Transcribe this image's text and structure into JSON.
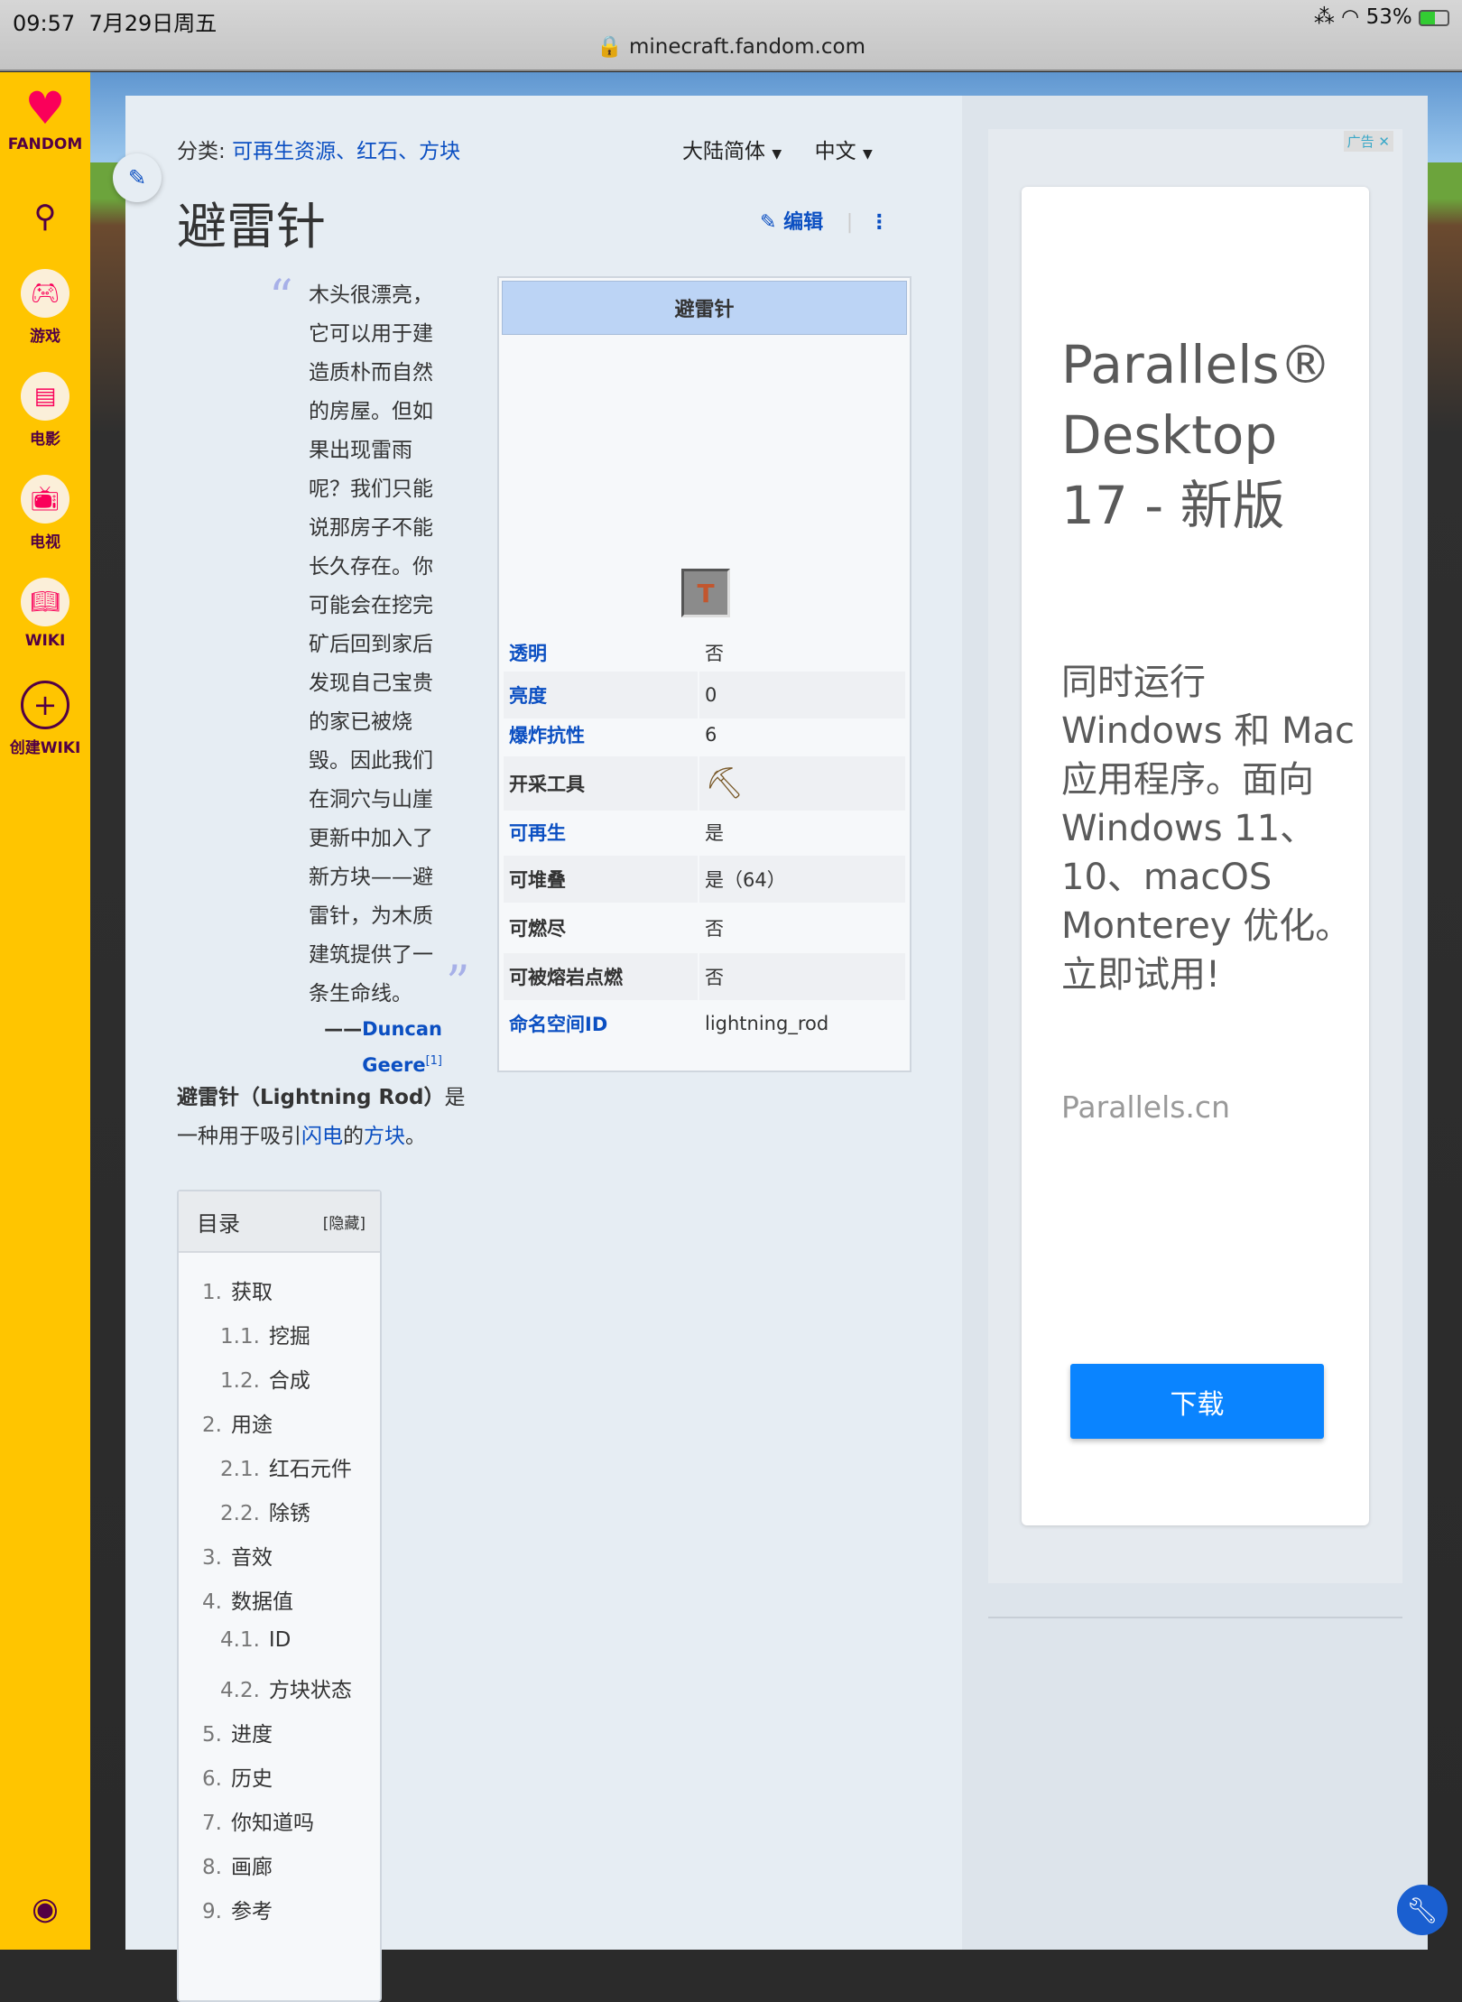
{
  "status": {
    "time": "09:57",
    "date": "7月29日周五",
    "battery": "53%",
    "url": "minecraft.fandom.com"
  },
  "rail": {
    "logo": "FANDOM",
    "items": [
      {
        "label": "游戏",
        "icon": "gamepad-icon"
      },
      {
        "label": "电影",
        "icon": "clapperboard-icon"
      },
      {
        "label": "电视",
        "icon": "tv-icon"
      },
      {
        "label": "WIKI",
        "icon": "book-icon"
      },
      {
        "label": "创建WIKI",
        "icon": "plus-icon"
      }
    ]
  },
  "page": {
    "category_label": "分类:",
    "categories": [
      "可再生资源",
      "红石",
      "方块"
    ],
    "sep": "、",
    "variant": "大陆简体",
    "language": "中文",
    "title": "避雷针",
    "edit": "编辑",
    "quote": "木头很漂亮，它可以用于建造质朴而自然的房屋。但如果出现雷雨呢？我们只能说那房子不能长久存在。你可能会在挖完矿后回到家后发现自己宝贵的家已被烧毁。因此我们在洞穴与山崖更新中加入了新方块——避雷针，为木质建筑提供了一条生命线。",
    "attrib_dash": "——",
    "attrib_name": "Duncan Geere",
    "attrib_ref": "[1]",
    "intro": {
      "bold": "避雷针（Lightning Rod）",
      "t1": "是一种用于吸引",
      "l1": "闪电",
      "t2": "的",
      "l2": "方块",
      "t3": "。"
    }
  },
  "infobox": {
    "title": "避雷针",
    "rows": [
      {
        "k": "透明",
        "v": "否",
        "link": true
      },
      {
        "k": "亮度",
        "v": "0",
        "link": true
      },
      {
        "k": "爆炸抗性",
        "v": "6",
        "link": true
      },
      {
        "k": "开采工具",
        "v": "⛏",
        "link": false
      },
      {
        "k": "可再生",
        "v": "是",
        "link": true
      },
      {
        "k": "可堆叠",
        "v": "是（64）",
        "link": false
      },
      {
        "k": "可燃尽",
        "v": "否",
        "link": false
      },
      {
        "k": "可被熔岩点燃",
        "v": "否",
        "link": false
      },
      {
        "k": "命名空间ID",
        "v": "lightning_rod",
        "link": true
      }
    ]
  },
  "toc": {
    "title": "目录",
    "hide": "[隐藏]",
    "items": [
      {
        "n": "1.",
        "t": "获取",
        "lvl": 1
      },
      {
        "n": "1.1.",
        "t": "挖掘",
        "lvl": 2
      },
      {
        "n": "1.2.",
        "t": "合成",
        "lvl": 2
      },
      {
        "n": "2.",
        "t": "用途",
        "lvl": 1
      },
      {
        "n": "2.1.",
        "t": "红石元件",
        "lvl": 2
      },
      {
        "n": "2.2.",
        "t": "除锈",
        "lvl": 2
      },
      {
        "n": "3.",
        "t": "音效",
        "lvl": 1
      },
      {
        "n": "4.",
        "t": "数据值",
        "lvl": 1
      },
      {
        "n": "4.1.",
        "t": "ID",
        "lvl": 2
      },
      {
        "n": "4.2.",
        "t": "方块状态",
        "lvl": 2
      },
      {
        "n": "5.",
        "t": "进度",
        "lvl": 1
      },
      {
        "n": "6.",
        "t": "历史",
        "lvl": 1
      },
      {
        "n": "7.",
        "t": "你知道吗",
        "lvl": 1
      },
      {
        "n": "8.",
        "t": "画廊",
        "lvl": 1
      },
      {
        "n": "9.",
        "t": "参考",
        "lvl": 1
      }
    ]
  },
  "ad": {
    "tag": "广告",
    "title": "Parallels® Desktop 17 - 新版",
    "body": "同时运行 Windows 和 Mac 应用程序。面向 Windows 11、10、macOS Monterey 优化。立即试用!",
    "url": "Parallels.cn",
    "button": "下载"
  }
}
